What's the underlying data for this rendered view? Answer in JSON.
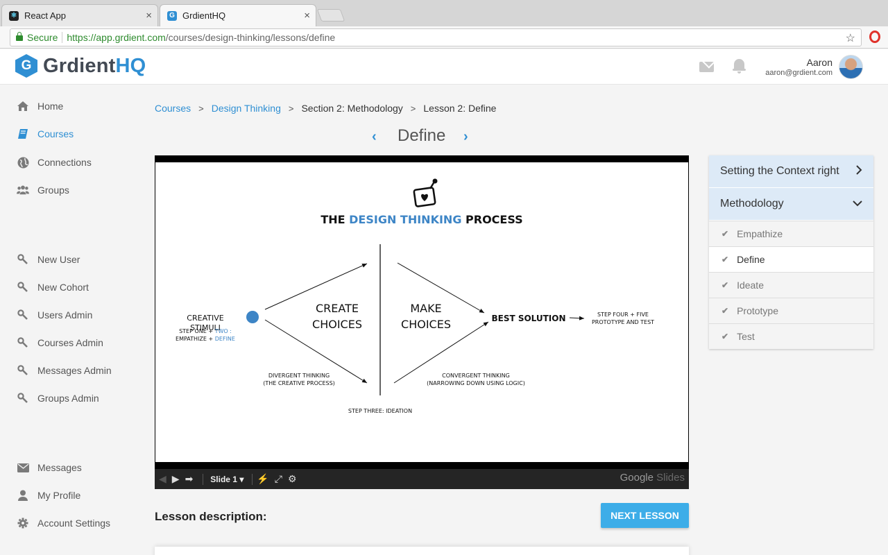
{
  "browser": {
    "tabs": [
      {
        "title": "React App",
        "favicon": "react-icon",
        "close": "×"
      },
      {
        "title": "GrdientHQ",
        "favicon": "grdient-favicon",
        "close": "×"
      }
    ],
    "secure_label": "Secure",
    "url_base": "https://app.grdient.com",
    "url_path": "/courses/design-thinking/lessons/define"
  },
  "header": {
    "logo_mark": "G",
    "logo_text_1": "Grdient",
    "logo_text_2": "HQ",
    "user_name": "Aaron",
    "user_email": "aaron@grdient.com"
  },
  "sidebar": {
    "items": [
      {
        "label": "Home",
        "icon": "home-icon"
      },
      {
        "label": "Courses",
        "icon": "book-icon",
        "active": true
      },
      {
        "label": "Connections",
        "icon": "globe-icon"
      },
      {
        "label": "Groups",
        "icon": "users-icon"
      },
      {
        "label": "New User",
        "icon": "wrench-icon"
      },
      {
        "label": "New Cohort",
        "icon": "wrench-icon"
      },
      {
        "label": "Users Admin",
        "icon": "wrench-icon"
      },
      {
        "label": "Courses Admin",
        "icon": "wrench-icon"
      },
      {
        "label": "Messages Admin",
        "icon": "wrench-icon"
      },
      {
        "label": "Groups Admin",
        "icon": "wrench-icon"
      },
      {
        "label": "Messages",
        "icon": "envelope-icon"
      },
      {
        "label": "My Profile",
        "icon": "user-icon"
      },
      {
        "label": "Account Settings",
        "icon": "gear-icon"
      }
    ]
  },
  "breadcrumb": {
    "items": [
      "Courses",
      "Design Thinking",
      "Section 2: Methodology",
      "Lesson 2: Define"
    ],
    "separator": ">"
  },
  "lesson": {
    "title": "Define",
    "prev": "‹",
    "next": "›"
  },
  "slide": {
    "title_a": "THE ",
    "title_b": "DESIGN THINKING",
    "title_c": " PROCESS",
    "creative_1": "CREATIVE",
    "creative_2": "STIMULI",
    "step_one_a": "STEP ONE + ",
    "step_one_b": "TWO :",
    "step_one_c": "EMPATHIZE + ",
    "step_one_d": "DEFINE",
    "create_1": "CREATE",
    "create_2": "CHOICES",
    "make_1": "MAKE",
    "make_2": "CHOICES",
    "best": "BEST SOLUTION",
    "step_four_1": "STEP FOUR + FIVE",
    "step_four_2": "PROTOTYPE AND TEST",
    "divergent_1": "DIVERGENT THINKING",
    "divergent_2": "(THE CREATIVE PROCESS)",
    "convergent_1": "CONVERGENT THINKING",
    "convergent_2": "(NARROWING DOWN USING LOGIC)",
    "step_three": "STEP THREE: IDEATION",
    "accent_color": "#3d85c6"
  },
  "player": {
    "slide_label": "Slide 1",
    "brand_1": "Google",
    "brand_2": " Slides"
  },
  "description_label": "Lesson description:",
  "next_lesson_label": "NEXT LESSON",
  "panel": {
    "sections": [
      {
        "title": "Setting the Context right",
        "chevron": "›"
      },
      {
        "title": "Methodology",
        "chevron": "⌄"
      }
    ],
    "lessons": [
      {
        "label": "Empathize",
        "check": "✔"
      },
      {
        "label": "Define",
        "check": "✔",
        "current": true
      },
      {
        "label": "Ideate",
        "check": "✔"
      },
      {
        "label": "Prototype",
        "check": "✔"
      },
      {
        "label": "Test",
        "check": "✔"
      }
    ]
  }
}
